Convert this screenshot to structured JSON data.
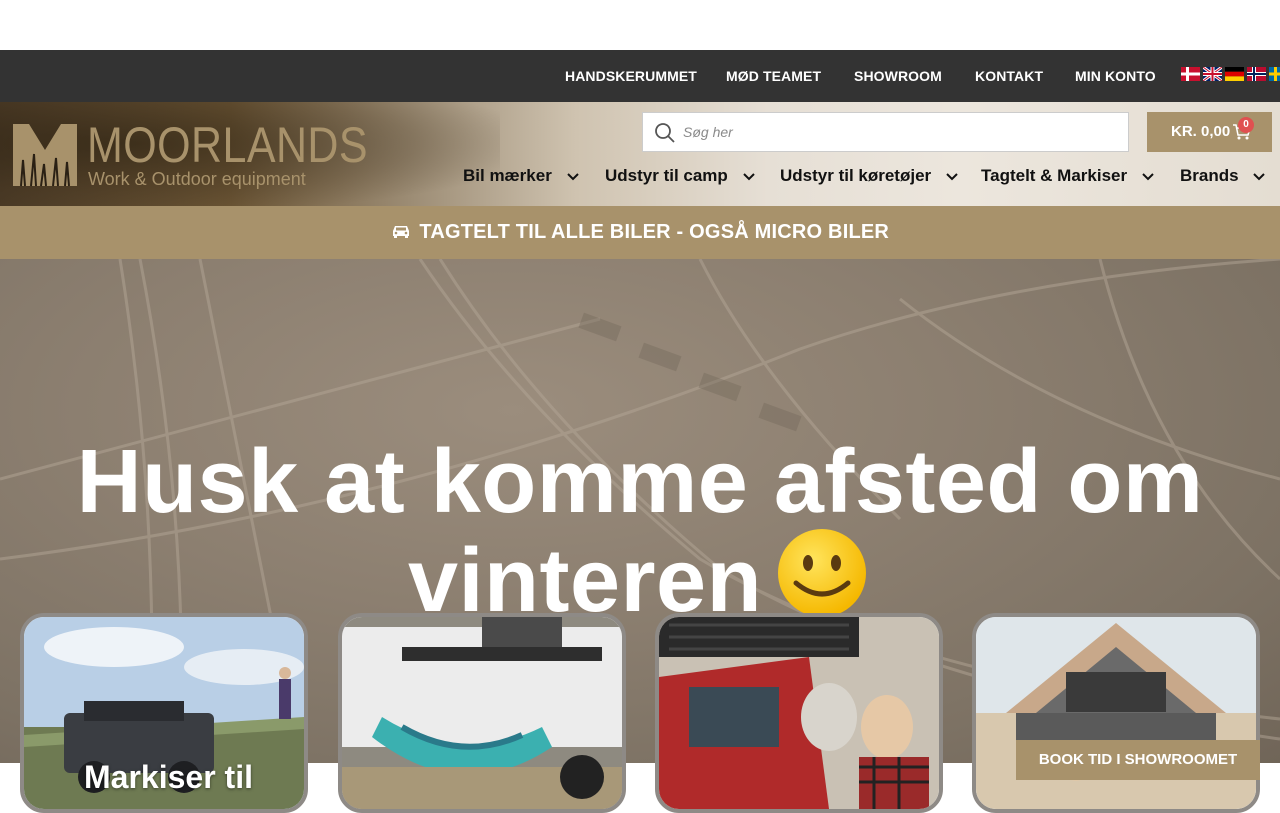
{
  "topnav": {
    "links": [
      "HANDSKERUMMET",
      "MØD TEAMET",
      "SHOWROOM",
      "KONTAKT",
      "MIN KONTO"
    ],
    "flags": [
      "danish-flag",
      "english-flag",
      "german-flag",
      "norwegian-flag",
      "swedish-flag"
    ]
  },
  "logo": {
    "word": "MOORLANDS",
    "tagline": "Work & Outdoor equipment",
    "color": "#a8926b"
  },
  "search": {
    "placeholder": "Søg her",
    "value": ""
  },
  "cart": {
    "total": "KR. 0,00",
    "count": "0"
  },
  "mainnav": {
    "items": [
      "Bil mærker",
      "Udstyr til camp",
      "Udstyr til køretøjer",
      "Tagtelt & Markiser",
      "Brands"
    ]
  },
  "announcement": {
    "text": "TAGTELT TIL ALLE BILER - OGSÅ MICRO BILER"
  },
  "hero": {
    "title": "Husk at komme afsted om vinteren"
  },
  "cards": [
    {
      "title": "Markiser til"
    },
    {
      "title": ""
    },
    {
      "title": ""
    },
    {
      "title": ""
    }
  ],
  "book_button": {
    "label": "BOOK TID I SHOWROOMET"
  },
  "colors": {
    "accent": "#a8926b",
    "topnav_bg": "#333333",
    "badge": "#e05050"
  }
}
